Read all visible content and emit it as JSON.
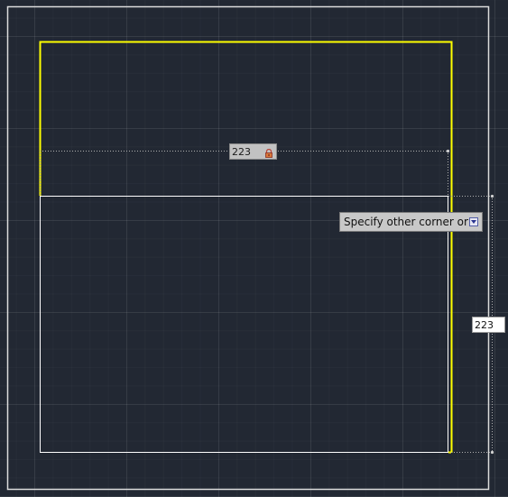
{
  "viewport": {
    "background_color": "#222833",
    "grid_color": "#3a404c"
  },
  "drawing": {
    "existing_rectangle_color": "#ffff00",
    "preview_rectangle_color": "#ffffff",
    "frame_color": "#dcdcdc",
    "dimension_line_color": "#b0b0b0"
  },
  "dimension_inputs": {
    "width_value": "223",
    "width_locked": true,
    "height_value": "223"
  },
  "command_prompt": {
    "text": "Specify other corner or",
    "has_options_dropdown": true
  }
}
